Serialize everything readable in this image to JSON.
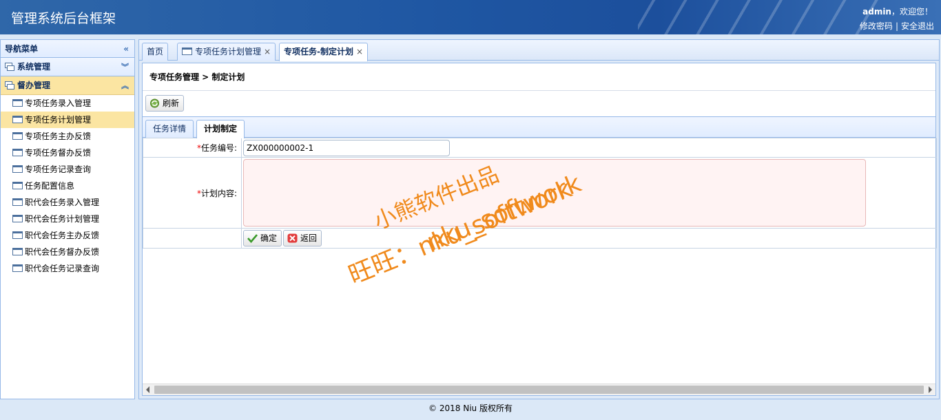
{
  "header": {
    "title": "管理系统后台框架",
    "user": "admin",
    "welcome_suffix": "，欢迎您！",
    "change_password": "修改密码",
    "separator": "|",
    "logout": "安全退出"
  },
  "sidebar": {
    "title": "导航菜单",
    "collapse_glyph": "«",
    "groups": [
      {
        "label": "系统管理",
        "arrow": "︾"
      },
      {
        "label": "督办管理",
        "arrow": "︽"
      }
    ],
    "items": [
      {
        "label": "专项任务录入管理"
      },
      {
        "label": "专项任务计划管理"
      },
      {
        "label": "专项任务主办反馈"
      },
      {
        "label": "专项任务督办反馈"
      },
      {
        "label": "专项任务记录查询"
      },
      {
        "label": "任务配置信息"
      },
      {
        "label": "职代会任务录入管理"
      },
      {
        "label": "职代会任务计划管理"
      },
      {
        "label": "职代会任务主办反馈"
      },
      {
        "label": "职代会任务督办反馈"
      },
      {
        "label": "职代会任务记录查询"
      }
    ]
  },
  "tabs": [
    {
      "label": "首页"
    },
    {
      "label": "专项任务计划管理",
      "close": "×"
    },
    {
      "label": "专项任务-制定计划",
      "close": "×"
    }
  ],
  "breadcrumb": "专项任务管理 > 制定计划",
  "toolbar": {
    "refresh": "刷新"
  },
  "subtabs": [
    {
      "label": "任务详情"
    },
    {
      "label": "计划制定"
    }
  ],
  "form": {
    "required_mark": "*",
    "task_no_label": "任务编号:",
    "task_no_value": "ZX000000002-1",
    "plan_label": "计划内容:",
    "plan_value": "",
    "confirm": "确定",
    "back": "返回"
  },
  "watermark": {
    "line1": "小熊软件出品",
    "line2": "nku_softwork",
    "line3": "旺旺：nku_softwork"
  },
  "footer": "© 2018 Niu 版权所有",
  "colors": {
    "accent": "#1f57a3",
    "selected": "#fbe5a2",
    "watermark": "#f08a1c",
    "required": "#e00000"
  }
}
